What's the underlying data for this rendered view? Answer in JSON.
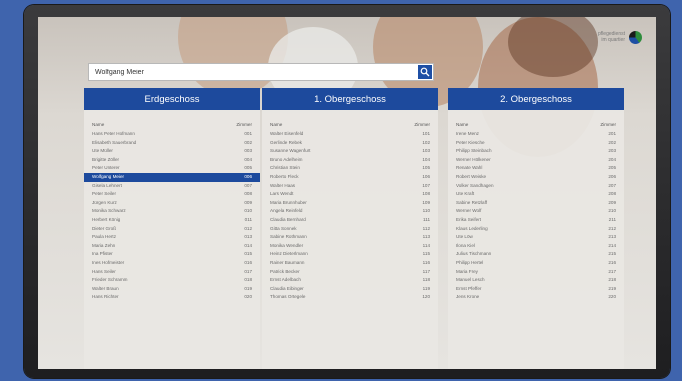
{
  "search": {
    "value": "Wolfgang Meier"
  },
  "logo": {
    "line1": "pflegedienst",
    "line2": "im quartier"
  },
  "columns": [
    {
      "title": "Erdgeschoss",
      "name_header": "Name",
      "room_header": "Zimmer",
      "rows": [
        {
          "name": "Hans Peter Hofmann",
          "room": "001"
        },
        {
          "name": "Elisabeth Sauerbrand",
          "room": "002"
        },
        {
          "name": "Ute Müller",
          "room": "003"
        },
        {
          "name": "Brigitte Zöller",
          "room": "004"
        },
        {
          "name": "Peter Unterer",
          "room": "005"
        },
        {
          "name": "Wolfgang Meier",
          "room": "006"
        },
        {
          "name": "Gisela Lehnert",
          "room": "007"
        },
        {
          "name": "Peter Seiler",
          "room": "008"
        },
        {
          "name": "Jürgen Kurz",
          "room": "009"
        },
        {
          "name": "Monika Schwarz",
          "room": "010"
        },
        {
          "name": "Herbert König",
          "room": "011"
        },
        {
          "name": "Dieter Groß",
          "room": "012"
        },
        {
          "name": "Paula Hertz",
          "room": "013"
        },
        {
          "name": "Maria Zehn",
          "room": "014"
        },
        {
          "name": "Ina Pfister",
          "room": "015"
        },
        {
          "name": "Ines Hofmeister",
          "room": "016"
        },
        {
          "name": "Hans Seiler",
          "room": "017"
        },
        {
          "name": "Frieder Schramm",
          "room": "018"
        },
        {
          "name": "Walter Braun",
          "room": "019"
        },
        {
          "name": "Hans Richter",
          "room": "020"
        }
      ]
    },
    {
      "title": "1. Obergeschoss",
      "name_header": "Name",
      "room_header": "Zimmer",
      "rows": [
        {
          "name": "Walter Eisenfeld",
          "room": "101"
        },
        {
          "name": "Gerlinde Rebek",
          "room": "102"
        },
        {
          "name": "Susanne Wagenfurt",
          "room": "103"
        },
        {
          "name": "Bruno Adelheim",
          "room": "104"
        },
        {
          "name": "Christian Stein",
          "room": "105"
        },
        {
          "name": "Roberto Fleck",
          "room": "106"
        },
        {
          "name": "Walter Haas",
          "room": "107"
        },
        {
          "name": "Lars Wendt",
          "room": "108"
        },
        {
          "name": "Maria Brunnhuber",
          "room": "109"
        },
        {
          "name": "Angela Reinfeld",
          "room": "110"
        },
        {
          "name": "Claudia Bernhard",
          "room": "111"
        },
        {
          "name": "Gitta Sonnek",
          "room": "112"
        },
        {
          "name": "Sabine Rothmann",
          "room": "113"
        },
        {
          "name": "Monika Wendler",
          "room": "114"
        },
        {
          "name": "Heinz Dieterlmann",
          "room": "115"
        },
        {
          "name": "Rainer Baumann",
          "room": "116"
        },
        {
          "name": "Patrick Becker",
          "room": "117"
        },
        {
          "name": "Ernst Adelbach",
          "room": "118"
        },
        {
          "name": "Claudia Eibinger",
          "room": "119"
        },
        {
          "name": "Thomas Ortegele",
          "room": "120"
        }
      ]
    },
    {
      "title": "2. Obergeschoss",
      "name_header": "Name",
      "room_header": "Zimmer",
      "rows": [
        {
          "name": "Irene Menz",
          "room": "201"
        },
        {
          "name": "Peter Kiesche",
          "room": "202"
        },
        {
          "name": "Philipp Steinbach",
          "room": "203"
        },
        {
          "name": "Werner Hölkener",
          "room": "204"
        },
        {
          "name": "Renate Wahl",
          "room": "205"
        },
        {
          "name": "Robert Weiske",
          "room": "206"
        },
        {
          "name": "Volker Sandhagen",
          "room": "207"
        },
        {
          "name": "Ute Kraft",
          "room": "208"
        },
        {
          "name": "Sabine Retzlaff",
          "room": "209"
        },
        {
          "name": "Werner Wolf",
          "room": "210"
        },
        {
          "name": "Erika Seifert",
          "room": "211"
        },
        {
          "name": "Klaus Lederling",
          "room": "212"
        },
        {
          "name": "Ute Löw",
          "room": "213"
        },
        {
          "name": "Ilona Kiel",
          "room": "214"
        },
        {
          "name": "Julius Tischmann",
          "room": "215"
        },
        {
          "name": "Philipp Hertel",
          "room": "216"
        },
        {
          "name": "Maria Frey",
          "room": "217"
        },
        {
          "name": "Manuel Lesch",
          "room": "218"
        },
        {
          "name": "Ernst Pfeffer",
          "room": "219"
        },
        {
          "name": "Jens Krone",
          "room": "220"
        }
      ]
    }
  ],
  "selected": {
    "column": 0,
    "row": 5
  },
  "colors": {
    "accent": "#1d4a9d",
    "background": "#3f64ad"
  }
}
